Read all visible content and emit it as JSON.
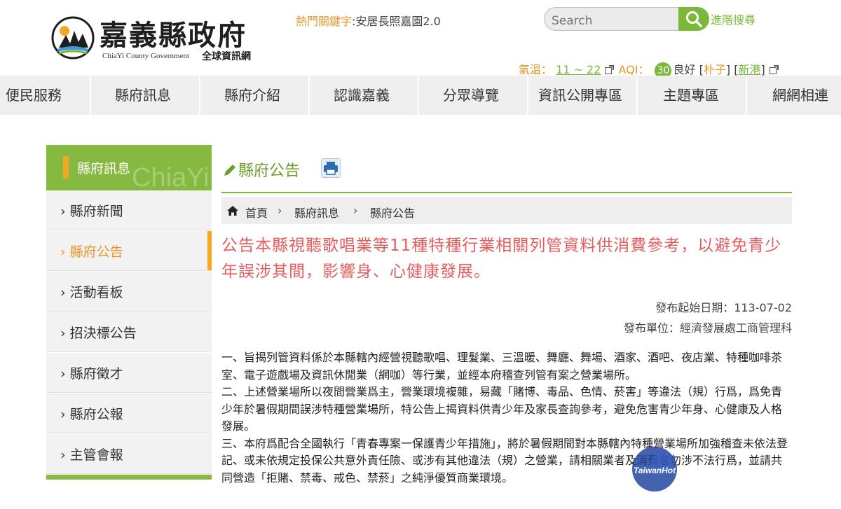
{
  "header": {
    "logo_title": "嘉義縣政府",
    "logo_en": "ChiaYi County Government",
    "logo_sub": "全球資訊網",
    "hot_keywords_label": "熱門關鍵字",
    "hot_keywords_value": ":安居長照嘉園2.0",
    "search_placeholder": "Search",
    "advanced_search": "進階搜尋",
    "weather": {
      "temp_label": "氣溫：",
      "temp_value": "11 ~ 22",
      "aqi_label": "AQI：",
      "aqi_value": "30",
      "aqi_status": "良好",
      "bracket_open_1": "[",
      "site_1": "朴子",
      "bracket_mid": "] [",
      "site_2": "新港",
      "bracket_close": "]"
    }
  },
  "nav": {
    "items": [
      "便民服務",
      "縣府訊息",
      "縣府介紹",
      "認識嘉義",
      "分眾導覽",
      "資訊公開專區",
      "主題專區",
      "網網相連"
    ]
  },
  "sidebar": {
    "title": "縣府訊息",
    "watermark": "ChiaYi",
    "items": [
      {
        "label": "› 縣府新聞"
      },
      {
        "label": "› 縣府公告"
      },
      {
        "label": "› 活動看板"
      },
      {
        "label": "› 招決標公告"
      },
      {
        "label": "› 縣府徵才"
      },
      {
        "label": "› 縣府公報"
      },
      {
        "label": "› 主管會報"
      }
    ],
    "active_index": 1
  },
  "main": {
    "page_title": "縣府公告",
    "breadcrumb": [
      "首頁",
      "縣府訊息",
      "縣府公告"
    ],
    "breadcrumb_sep": "›",
    "headline": "公告本縣視聽歌唱業等11種特種行業相關列管資料供消費參考，以避免青少年誤涉其間，影響身、心健康發展。",
    "publish_date": "發布起始日期：113-07-02",
    "publish_unit": "發布單位：經濟發展處工商管理科",
    "paragraphs": [
      "一、旨揭列管資料係於本縣轄內經營視聽歌唱、理髮業、三溫暖、舞廳、舞場、酒家、酒吧、夜店業、特種咖啡茶室、電子遊戲場及資訊休閒業（網咖）等行業，並經本府稽查列管有案之營業場所。",
      "二、上述營業場所以夜間營業爲主，營業環境複雜，易藏「賭博、毒品、色情、菸害」等違法（規）行爲，爲免青少年於暑假期間誤涉特種營業場所，特公告上揭資料供青少年及家長查詢參考，避免危害青少年身、心健康及人格發展。",
      "三、本府爲配合全國執行「青春專案一保護青少年措施」，將於暑假期間對本縣轄內特種營業場所加強稽查未依法登記、或未依規定投保公共意外責任險、或涉有其他違法（規）之營業，請相關業者及消費者勿涉不法行爲，並請共同營造「拒賭、禁毒、戒色、禁菸」之純淨優質商業環境。"
    ]
  },
  "watermark_logo": "TaiwanHot",
  "colors": {
    "brand_green": "#86b940",
    "accent_orange": "#f5a623",
    "headline_red": "#e55d5d"
  }
}
